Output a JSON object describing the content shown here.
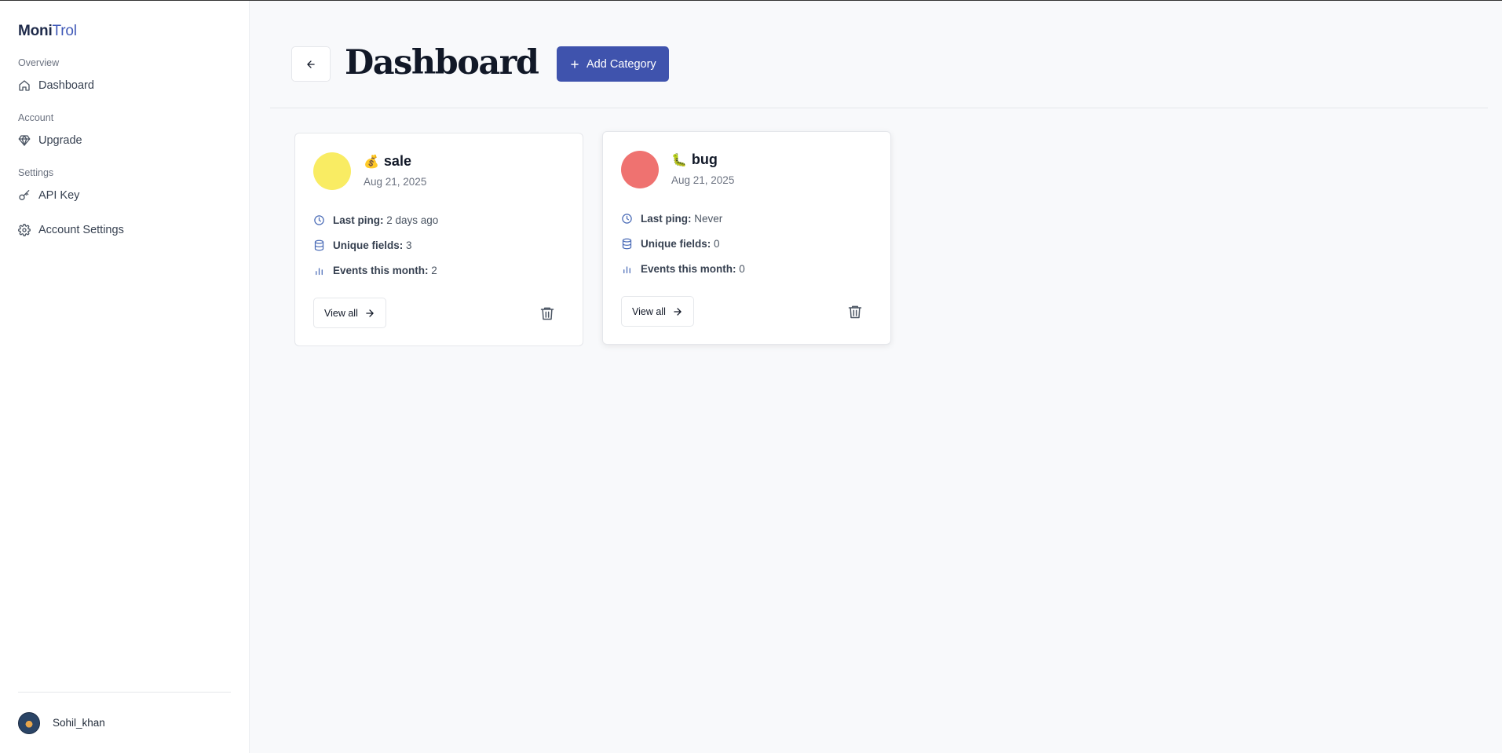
{
  "sidebar": {
    "brand_part1": "Moni",
    "brand_part2": "Trol",
    "sections": [
      {
        "title": "Overview",
        "items": [
          {
            "label": "Dashboard",
            "icon": "home-icon"
          }
        ]
      },
      {
        "title": "Account",
        "items": [
          {
            "label": "Upgrade",
            "icon": "gem-icon"
          }
        ]
      },
      {
        "title": "Settings",
        "items": [
          {
            "label": "API Key",
            "icon": "key-icon"
          },
          {
            "label": "Account Settings",
            "icon": "gear-icon"
          }
        ]
      }
    ],
    "user": {
      "name": "Sohil_khan"
    }
  },
  "header": {
    "title": "Dashboard",
    "add_button_label": "Add Category"
  },
  "cards": [
    {
      "emoji": "💰",
      "name": "sale",
      "date": "Aug 21, 2025",
      "color": "#f9ec63",
      "last_ping_label": "Last ping:",
      "last_ping_value": "2 days ago",
      "unique_fields_label": "Unique fields:",
      "unique_fields_value": "3",
      "events_label": "Events this month:",
      "events_value": "2",
      "view_all_label": "View all"
    },
    {
      "emoji": "🐛",
      "name": "bug",
      "date": "Aug 21, 2025",
      "color": "#ef7270",
      "last_ping_label": "Last ping:",
      "last_ping_value": "Never",
      "unique_fields_label": "Unique fields:",
      "unique_fields_value": "0",
      "events_label": "Events this month:",
      "events_value": "0",
      "view_all_label": "View all"
    }
  ],
  "colors": {
    "accent": "#3f53ad",
    "icon": "#4b6cb7"
  }
}
